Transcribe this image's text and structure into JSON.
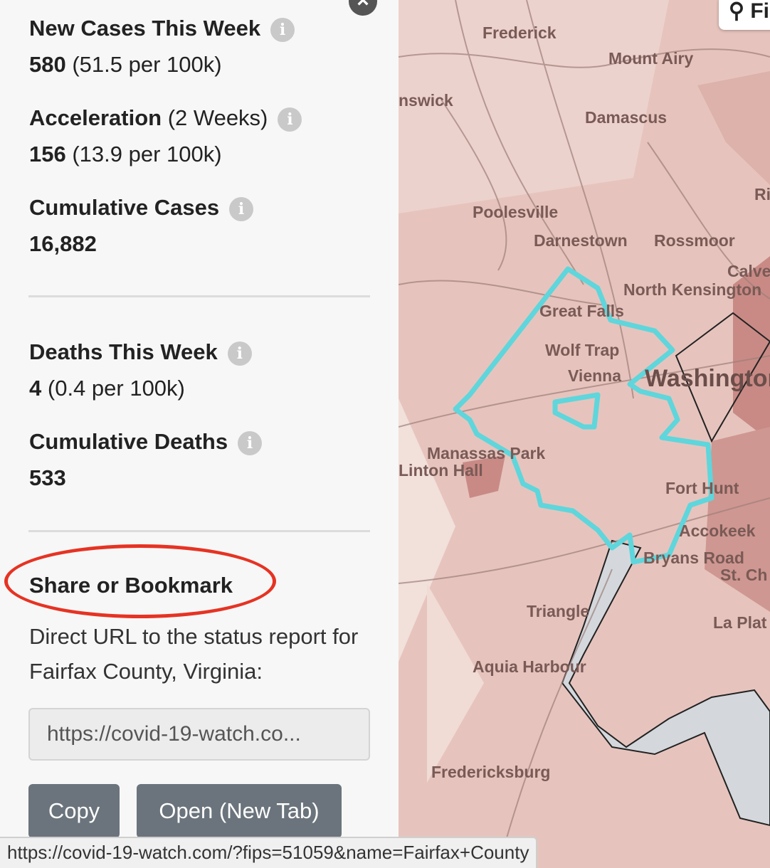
{
  "stats": [
    {
      "title": "New Cases This Week",
      "title_suffix": "",
      "value": "580",
      "value_detail": "(51.5 per 100k)"
    },
    {
      "title": "Acceleration",
      "title_suffix": "(2 Weeks)",
      "value": "156",
      "value_detail": "(13.9 per 100k)"
    },
    {
      "title": "Cumulative Cases",
      "title_suffix": "",
      "value": "16,882",
      "value_detail": ""
    },
    {
      "title": "Deaths This Week",
      "title_suffix": "",
      "value": "4",
      "value_detail": "(0.4 per 100k)"
    },
    {
      "title": "Cumulative Deaths",
      "title_suffix": "",
      "value": "533",
      "value_detail": ""
    }
  ],
  "info_icon": "info-icon",
  "close_icon": "close-icon",
  "share": {
    "title": "Share or Bookmark",
    "description": "Direct URL to the status report for Fairfax County, Virginia:",
    "url_value": "https://covid-19-watch.co...",
    "copy_label": "Copy",
    "open_label": "Open (New Tab)"
  },
  "status_bar": {
    "url": "https://covid-19-watch.com/?fips=51059&name=Fairfax+County"
  },
  "map": {
    "search_label": "Fi",
    "cities": [
      "Frederick",
      "Mount Airy",
      "nswick",
      "Damascus",
      "Ri",
      "Poolesville",
      "Darnestown",
      "Rossmoor",
      "Calve",
      "North Kensington",
      "Great Falls",
      "Wolf Trap",
      "Vienna",
      "Washington",
      "Manassas Park",
      "Linton Hall",
      "Fort Hunt",
      "Accokeek",
      "Bryans Road",
      "St. Ch",
      "Triangle",
      "La Plat",
      "Aquia Harbour",
      "Fredericksburg"
    ],
    "highlight_color": "#5ed6dc",
    "land_color": "#e6c4bd",
    "dark_region_color": "#c98a85",
    "water_color": "#d4d8dc"
  },
  "colors": {
    "annotation": "#e63323",
    "button": "#6b747c"
  }
}
